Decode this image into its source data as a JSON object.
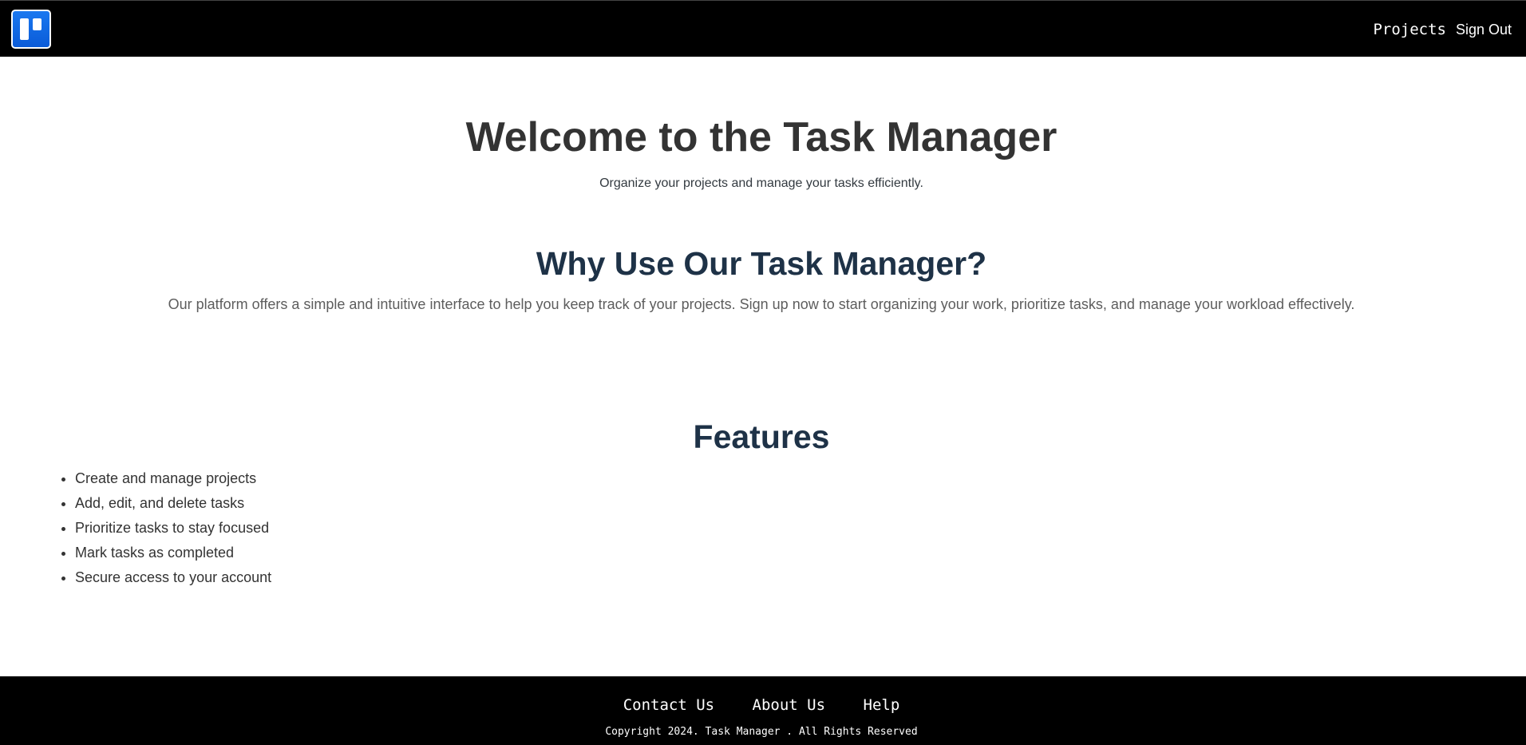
{
  "header": {
    "logo_icon": "trello-board-icon",
    "nav": {
      "projects_label": "Projects",
      "signout_label": "Sign Out"
    }
  },
  "hero": {
    "title": "Welcome to the Task Manager",
    "subtitle": "Organize your projects and manage your tasks efficiently."
  },
  "why": {
    "title": "Why Use Our Task Manager?",
    "text": "Our platform offers a simple and intuitive interface to help you keep track of your projects. Sign up now to start organizing your work, prioritize tasks, and manage your workload effectively."
  },
  "features": {
    "title": "Features",
    "items": [
      "Create and manage projects",
      "Add, edit, and delete tasks",
      "Prioritize tasks to stay focused",
      "Mark tasks as completed",
      "Secure access to your account"
    ]
  },
  "footer": {
    "links": {
      "contact": "Contact Us",
      "about": "About Us",
      "help": "Help"
    },
    "copyright": "Copyright 2024. Task Manager . All Rights Reserved"
  },
  "colors": {
    "header_bg": "#000000",
    "footer_bg": "#000000",
    "logo_blue": "#0a5bd8",
    "hero_title": "#333333",
    "section_title": "#1e3247",
    "body_text": "#5d5d5d"
  }
}
